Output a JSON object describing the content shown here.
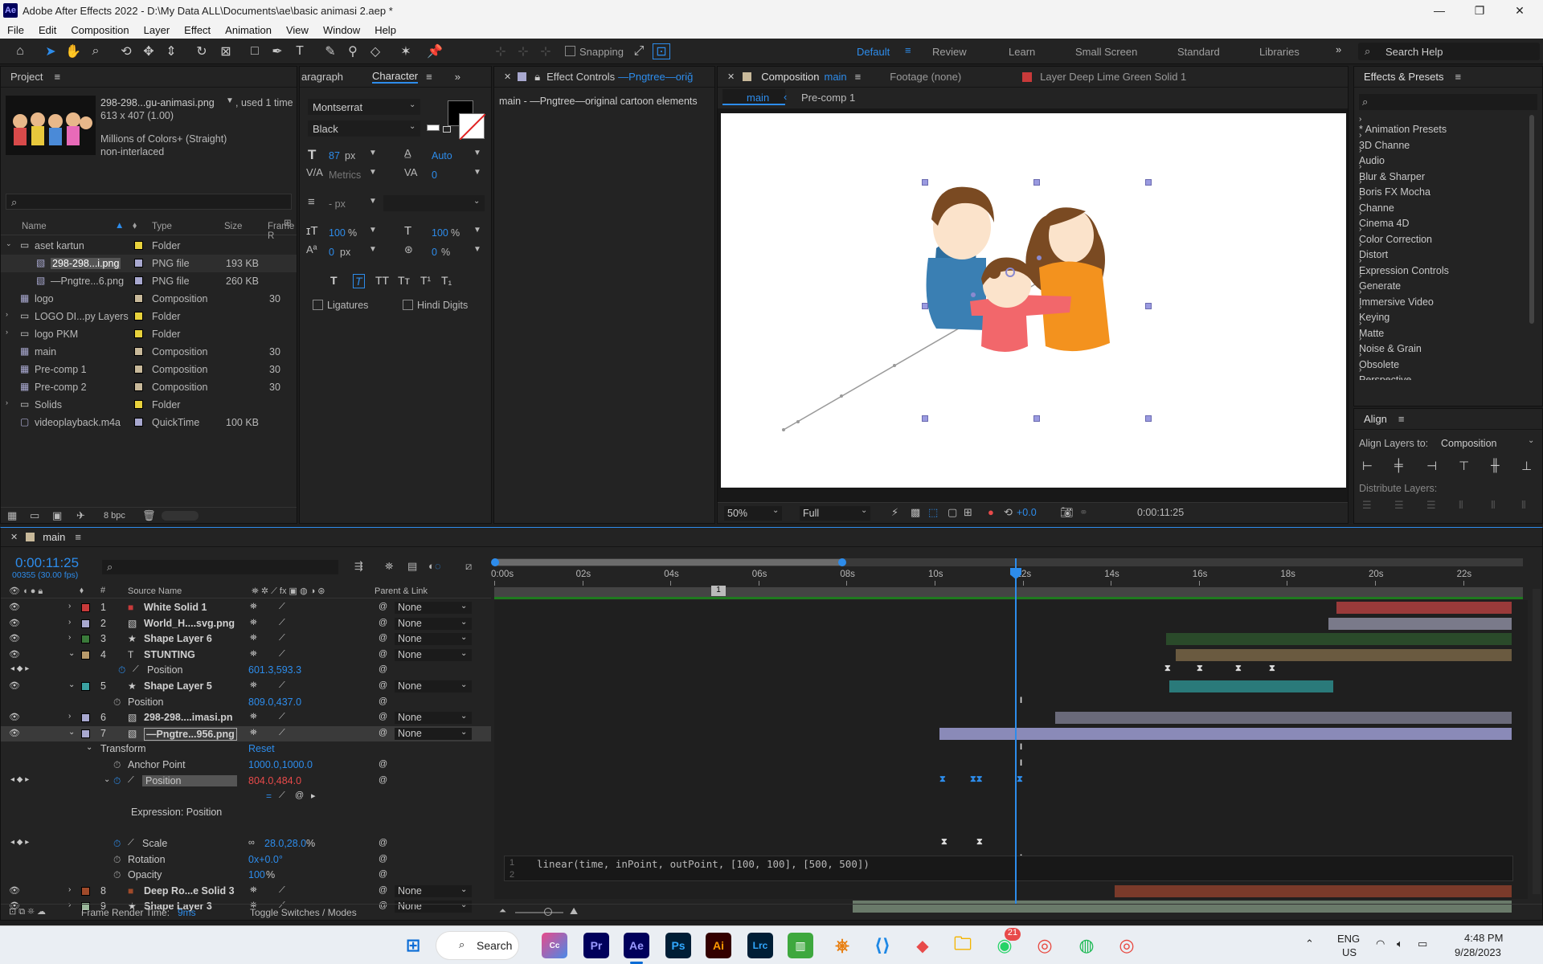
{
  "app": {
    "title": "Adobe After Effects 2022 - D:\\My Data ALL\\Documents\\ae\\basic animasi 2.aep *",
    "logo": "Ae"
  },
  "menu": [
    "File",
    "Edit",
    "Composition",
    "Layer",
    "Effect",
    "Animation",
    "View",
    "Window",
    "Help"
  ],
  "toolbar": {
    "snapping": "Snapping"
  },
  "workspaces": [
    "Default",
    "Review",
    "Learn",
    "Small Screen",
    "Standard",
    "Libraries"
  ],
  "search_help": "Search Help",
  "project": {
    "tab": "Project",
    "preview_name": "298-298...gu-animasi.png",
    "used": ", used 1 time",
    "dims": "613 x 407 (1.00)",
    "colors": "Millions of Colors+ (Straight)",
    "interlace": "non-interlaced",
    "columns": [
      "Name",
      "Type",
      "Size",
      "Frame R"
    ],
    "items": [
      {
        "name": "aset kartun",
        "type": "Folder",
        "size": "",
        "fr": "",
        "color": "#e8d23c",
        "level": 0,
        "icon": "folder"
      },
      {
        "name": "298-298...i.png",
        "type": "PNG file",
        "size": "193 KB",
        "fr": "",
        "color": "#a8a8cf",
        "level": 1,
        "icon": "file"
      },
      {
        "name": "—Pngtre...6.png",
        "type": "PNG file",
        "size": "260 KB",
        "fr": "",
        "color": "#a8a8cf",
        "level": 1,
        "icon": "file"
      },
      {
        "name": "logo",
        "type": "Composition",
        "size": "",
        "fr": "30",
        "color": "#c8b99a",
        "level": 0,
        "icon": "comp"
      },
      {
        "name": "LOGO DI...py Layers",
        "type": "Folder",
        "size": "",
        "fr": "",
        "color": "#e8d23c",
        "level": 0,
        "icon": "folder"
      },
      {
        "name": "logo PKM",
        "type": "Folder",
        "size": "",
        "fr": "",
        "color": "#e8d23c",
        "level": 0,
        "icon": "folder"
      },
      {
        "name": "main",
        "type": "Composition",
        "size": "",
        "fr": "30",
        "color": "#c8b99a",
        "level": 0,
        "icon": "comp"
      },
      {
        "name": "Pre-comp 1",
        "type": "Composition",
        "size": "",
        "fr": "30",
        "color": "#c8b99a",
        "level": 0,
        "icon": "comp"
      },
      {
        "name": "Pre-comp 2",
        "type": "Composition",
        "size": "",
        "fr": "30",
        "color": "#c8b99a",
        "level": 0,
        "icon": "comp"
      },
      {
        "name": "Solids",
        "type": "Folder",
        "size": "",
        "fr": "",
        "color": "#e8d23c",
        "level": 0,
        "icon": "folder"
      },
      {
        "name": "videoplayback.m4a",
        "type": "QuickTime",
        "size": "100 KB",
        "fr": "",
        "color": "#a8a8cf",
        "level": 0,
        "icon": "audio"
      }
    ],
    "bpc": "8 bpc"
  },
  "character": {
    "tabs": [
      "aragraph",
      "Character"
    ],
    "font": "Montserrat",
    "style": "Black",
    "size": "87",
    "size_unit": "px",
    "leading": "Auto",
    "kerning": "Metrics",
    "tracking": "0",
    "stroke": "- px",
    "vscale": "100",
    "hscale": "100",
    "pct": "%",
    "baseline": "0",
    "baseline_unit": "px",
    "tsume": "0",
    "ligatures": "Ligatures",
    "hindi": "Hindi Digits"
  },
  "effect_controls": {
    "tab": "Effect Controls",
    "layer": "—Pngtree—oriğ",
    "line": "main - —Pngtree—original cartoon elements"
  },
  "comp": {
    "tab": "Composition",
    "tab_name": "main",
    "footage": "Footage (none)",
    "layer_tab": "Layer Deep Lime Green Solid 1",
    "breadcrumb": [
      "main",
      "Pre-comp 1"
    ],
    "zoom": "50%",
    "quality": "Full",
    "exposure": "+0.0",
    "time": "0:00:11:25"
  },
  "effects": {
    "tab": "Effects & Presets",
    "items": [
      "* Animation Presets",
      "3D Channe",
      "Audio",
      "Blur & Sharper",
      "Boris FX Mocha",
      "Channe",
      "Cinema 4D",
      "Color Correction",
      "Distort",
      "Expression Controls",
      "Generate",
      "Immersive Video",
      "Keying",
      "Matte",
      "Noise & Grain",
      "Obsolete",
      "Perspective"
    ]
  },
  "align": {
    "tab": "Align",
    "align_to_label": "Align Layers to:",
    "align_to": "Composition",
    "distribute": "Distribute Layers:"
  },
  "timeline": {
    "tab": "main",
    "timecode": "0:00:11:25",
    "frames": "00355 (30.00 fps)",
    "col_source": "Source Name",
    "col_parent": "Parent & Link",
    "ticks": [
      "0:00s",
      "02s",
      "04s",
      "06s",
      "08s",
      "10s",
      "12s",
      "14s",
      "16s",
      "18s",
      "20s",
      "22s"
    ],
    "marker": "1",
    "layers": [
      {
        "num": "1",
        "name": "White Solid 1",
        "color": "#c83a3a",
        "icon": "solid",
        "parent": "None"
      },
      {
        "num": "2",
        "name": "World_H....svg.png",
        "color": "#a8a8cf",
        "icon": "file",
        "parent": "None"
      },
      {
        "num": "3",
        "name": "Shape Layer 6",
        "color": "#3a7a3a",
        "icon": "star",
        "parent": "None"
      },
      {
        "num": "4",
        "name": "STUNTING",
        "color": "#b89a6a",
        "icon": "text",
        "parent": "None"
      },
      {
        "prop": "Position",
        "value": "601.3,593.3"
      },
      {
        "num": "5",
        "name": "Shape Layer 5",
        "color": "#3aa0a0",
        "icon": "star",
        "parent": "None"
      },
      {
        "prop": "Position",
        "value": "809.0,437.0"
      },
      {
        "num": "6",
        "name": "298-298....imasi.pn",
        "color": "#a8a8cf",
        "icon": "file",
        "parent": "None"
      },
      {
        "num": "7",
        "name": "—Pngtre...956.png",
        "color": "#a8a8cf",
        "icon": "file",
        "parent": "None"
      }
    ],
    "transform": "Transform",
    "reset": "Reset",
    "anchor": {
      "label": "Anchor Point",
      "value": "1000.0,1000.0"
    },
    "position": {
      "label": "Position",
      "value": "804.0,484.0"
    },
    "expression_label": "Expression: Position",
    "expression": "linear(time, inPoint, outPoint, [100, 100], [500, 500])",
    "scale": {
      "label": "Scale",
      "value": "28.0,28.0",
      "unit": "%"
    },
    "rotation": {
      "label": "Rotation",
      "value": "0x+0.0°"
    },
    "opacity": {
      "label": "Opacity",
      "value": "100",
      "unit": "%"
    },
    "layers2": [
      {
        "num": "8",
        "name": "Deep Ro...e Solid 3",
        "color": "#a04a2a",
        "icon": "solid",
        "parent": "None"
      },
      {
        "num": "9",
        "name": "Shape Layer 3",
        "color": "#9ab89a",
        "icon": "star",
        "parent": "None"
      }
    ],
    "render_time": "Frame Render Time:",
    "render_ms": "9ms",
    "toggle": "Toggle Switches / Modes"
  },
  "taskbar": {
    "search": "Search",
    "lang": "ENG",
    "region": "US",
    "time": "4:48 PM",
    "date": "9/28/2023",
    "badge": "21"
  }
}
